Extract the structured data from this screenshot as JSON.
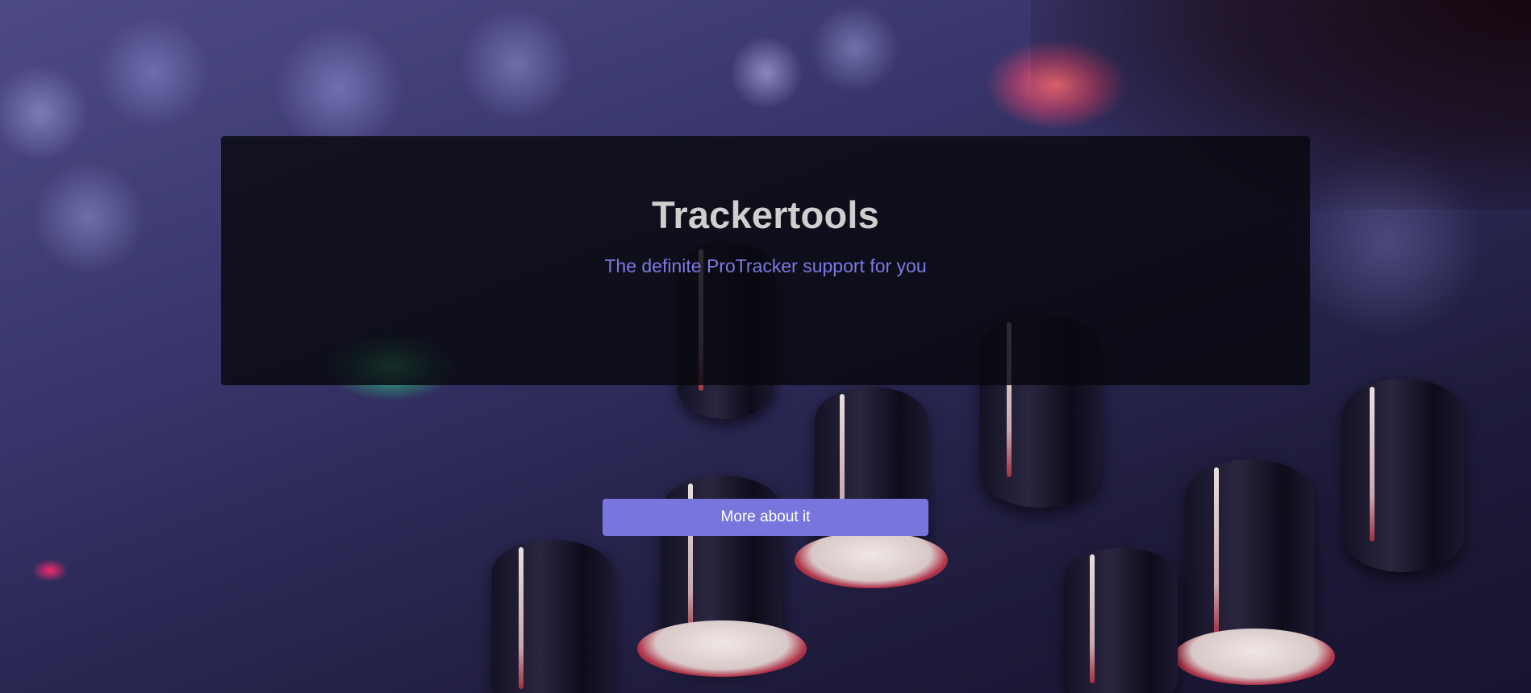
{
  "hero": {
    "title": "Trackertools",
    "subtitle": "The definite ProTracker support for you",
    "button_label": "More about it"
  },
  "background": {
    "image_subject": "audio-mixer-knobs-photo",
    "tint": "#3b3870"
  },
  "colors": {
    "accent": "#7876dd",
    "subtitle": "#7b7ae4",
    "title": "#cfcfcf",
    "panel": "#08080e"
  }
}
